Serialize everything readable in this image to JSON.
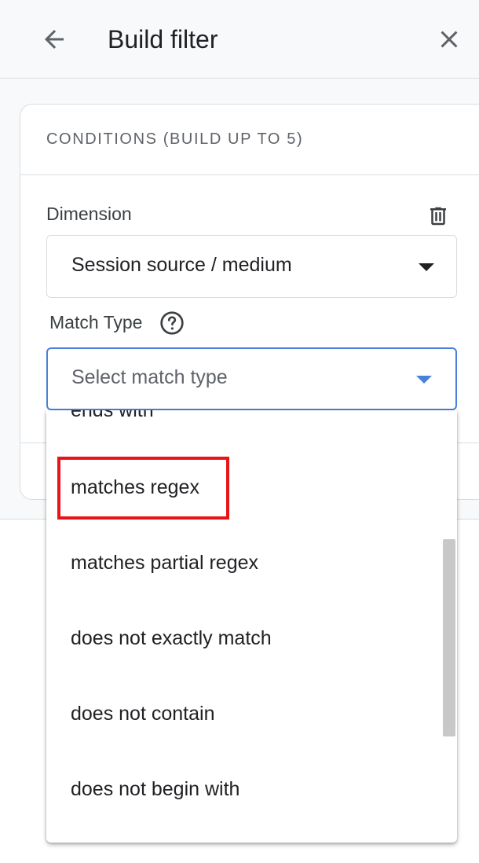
{
  "header": {
    "title": "Build filter",
    "back_icon": "arrow-left-icon",
    "close_icon": "close-icon"
  },
  "card": {
    "section_title": "CONDITIONS (BUILD UP TO 5)",
    "dimension": {
      "label": "Dimension",
      "value": "Session source / medium",
      "delete_icon": "trash-icon"
    },
    "match_type": {
      "label": "Match Type",
      "help_icon": "help-circle-icon",
      "placeholder": "Select match type"
    }
  },
  "dropdown": {
    "items": [
      "ends with",
      "matches regex",
      "matches partial regex",
      "does not exactly match",
      "does not contain",
      "does not begin with"
    ],
    "highlighted_item": "matches regex"
  },
  "colors": {
    "focus_blue": "#4a80d8",
    "highlight_red": "#e5151a",
    "border_gray": "#dadce0"
  }
}
